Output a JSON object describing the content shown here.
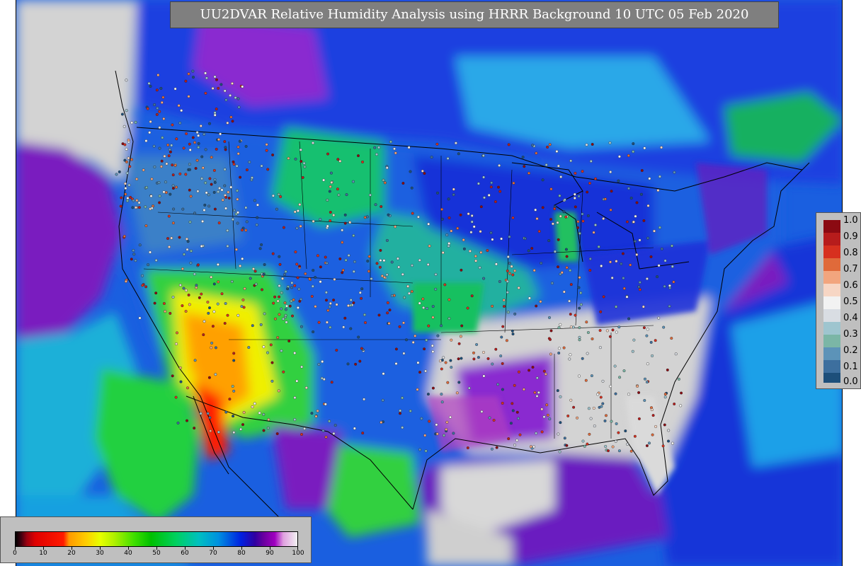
{
  "title": "UU2DVAR Relative Humidity Analysis using HRRR Background 10 UTC 05 Feb 2020",
  "rh_colorbar": {
    "ticks": [
      "0",
      "10",
      "20",
      "30",
      "40",
      "50",
      "60",
      "70",
      "80",
      "90",
      "100"
    ]
  },
  "obs_colorbar": {
    "labels": [
      "1.0",
      "0.9",
      "0.8",
      "0.7",
      "0.6",
      "0.5",
      "0.4",
      "0.3",
      "0.2",
      "0.1",
      "0.0"
    ],
    "colors": [
      "#8b0a12",
      "#b71c1c",
      "#d7301f",
      "#e06a3a",
      "#f2a57e",
      "#f7d6c4",
      "#f2f2f2",
      "#d9dde3",
      "#9ec5cf",
      "#7bb6a6",
      "#5c93b8",
      "#3d6f9e",
      "#1d4f7a"
    ]
  },
  "palette": {
    "ocean_green": "#25d24a",
    "ocean_cyan": "#18b8d8",
    "ocean_blue": "#1a6fe6",
    "ocean_deep": "#1030d0",
    "land_gray": "#d3d3d3",
    "purple": "#7a1cbf",
    "orange": "#ff9a00",
    "red": "#ff1a00",
    "yellow": "#ffee00"
  }
}
